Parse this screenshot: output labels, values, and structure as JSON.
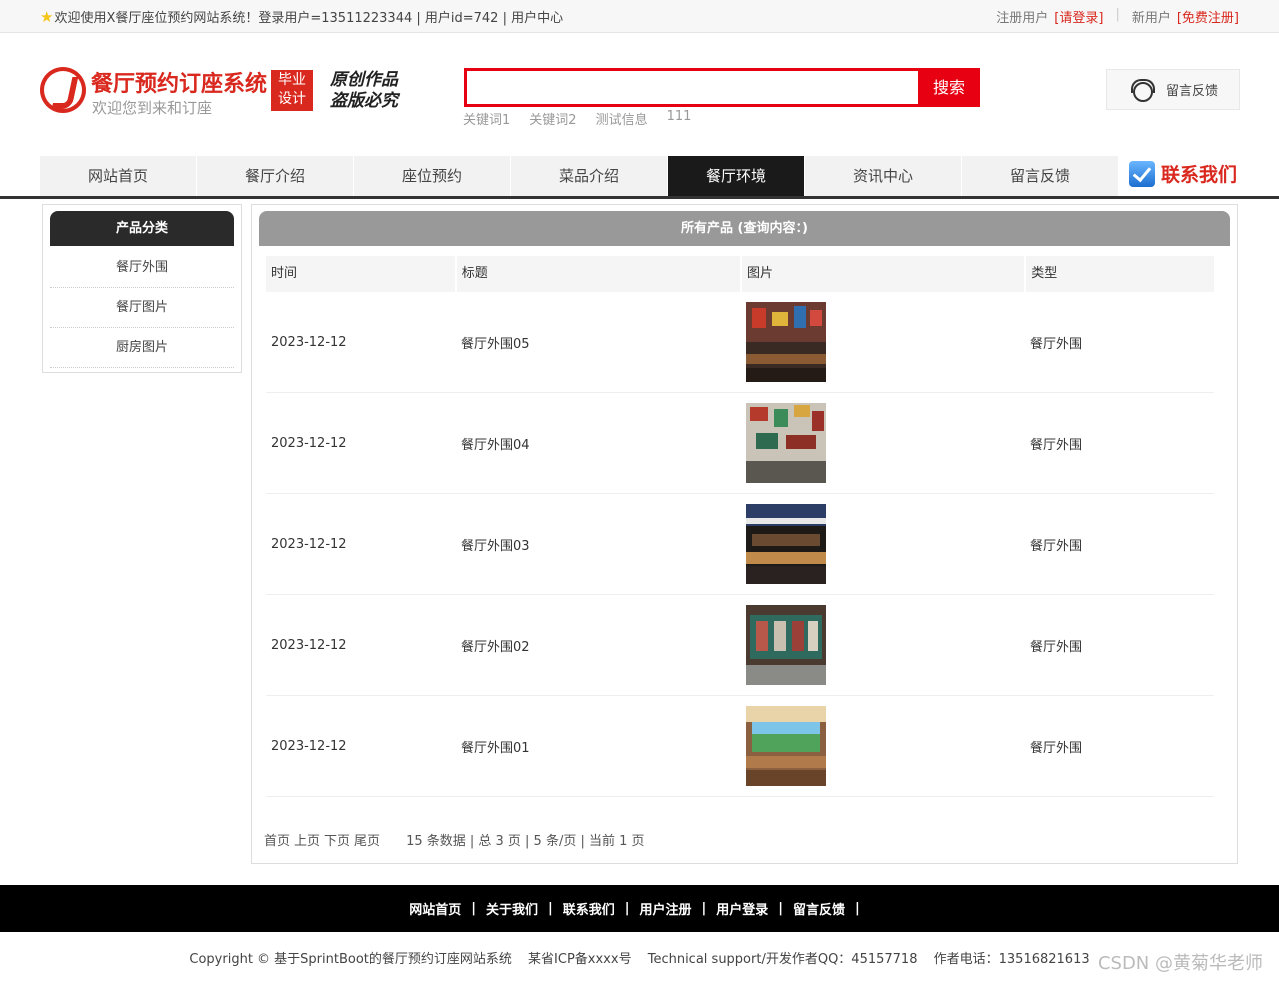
{
  "topbar": {
    "welcome": "欢迎使用X餐厅座位预约网站系统！登录用户=13511223344 | 用户id=742 | 用户中心",
    "registered_label": "注册用户",
    "login_link": "[请登录]",
    "new_user_label": "新用户",
    "register_link": "[免费注册]"
  },
  "header": {
    "title": "餐厅预约订座系统",
    "subtitle": "欢迎您到来和订座",
    "badge_line1": "毕业",
    "badge_line2": "设计",
    "slogan_line1": "原创作品",
    "slogan_line2": "盗版必究"
  },
  "search": {
    "value": "",
    "placeholder": "",
    "button": "搜索",
    "keywords": [
      "关键词1",
      "关键词2",
      "测试信息",
      "111"
    ]
  },
  "feedback_button": "留言反馈",
  "nav": {
    "items": [
      "网站首页",
      "餐厅介绍",
      "座位预约",
      "菜品介绍",
      "餐厅环境",
      "资讯中心",
      "留言反馈"
    ],
    "active": "餐厅环境",
    "contact": "联系我们"
  },
  "sidebar": {
    "title": "产品分类",
    "items": [
      "餐厅外围",
      "餐厅图片",
      "厨房图片"
    ]
  },
  "main": {
    "title": "所有产品 (查询内容：)",
    "columns": [
      "时间",
      "标题",
      "图片",
      "类型"
    ],
    "rows": [
      {
        "time": "2023-12-12",
        "title": "餐厅外围05",
        "type": "餐厅外围"
      },
      {
        "time": "2023-12-12",
        "title": "餐厅外围04",
        "type": "餐厅外围"
      },
      {
        "time": "2023-12-12",
        "title": "餐厅外围03",
        "type": "餐厅外围"
      },
      {
        "time": "2023-12-12",
        "title": "餐厅外围02",
        "type": "餐厅外围"
      },
      {
        "time": "2023-12-12",
        "title": "餐厅外围01",
        "type": "餐厅外围"
      }
    ],
    "pager": {
      "first": "首页",
      "prev": "上页",
      "next": "下页",
      "last": "尾页",
      "summary": "15 条数据 | 总 3 页 | 5 条/页 | 当前 1 页"
    }
  },
  "footer": {
    "links": [
      "网站首页",
      "关于我们",
      "联系我们",
      "用户注册",
      "用户登录",
      "留言反馈"
    ],
    "copyright": "Copyright © 基于SprintBoot的餐厅预约订座网站系统",
    "icp": "某省ICP备xxxx号",
    "support": "Technical support/开发作者QQ：45157718",
    "phone": "作者电话：13516821613"
  },
  "watermark": "CSDN @黄菊华老师",
  "colors": {
    "brand_red": "#d9281e",
    "search_red": "#e60012",
    "nav_active": "#1a1a1a"
  }
}
